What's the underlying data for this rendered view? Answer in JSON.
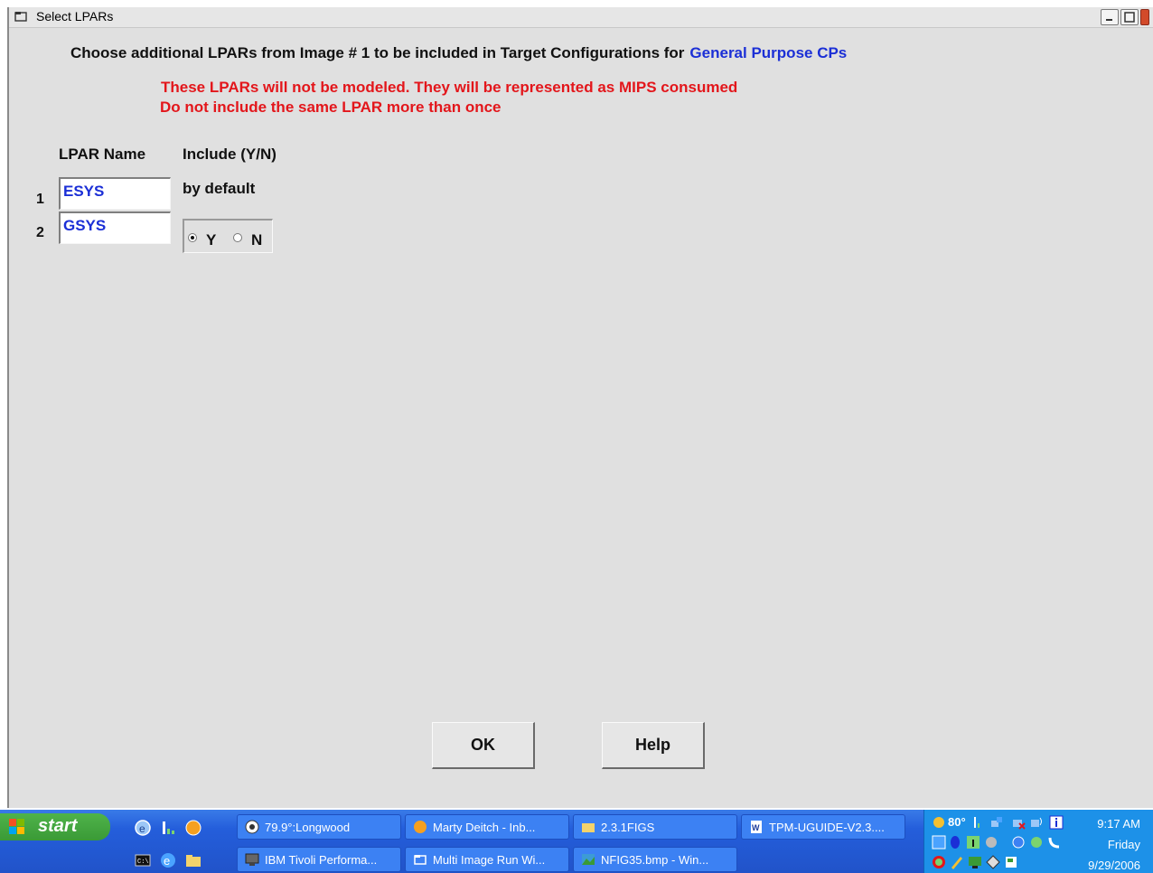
{
  "window": {
    "title": "Select LPARs"
  },
  "instruction": {
    "text": "Choose additional LPARs from Image # 1 to be included in Target Configurations for",
    "highlight": "General Purpose CPs"
  },
  "warnings": [
    "These LPARs will not be modeled. They will be represented as MIPS consumed",
    "Do not include the same LPAR more than once"
  ],
  "table": {
    "col_lpar": "LPAR Name",
    "col_include": "Include (Y/N)",
    "by_default": "by default",
    "rows": [
      {
        "num": "1",
        "name": "ESYS"
      },
      {
        "num": "2",
        "name": "GSYS"
      }
    ],
    "radio_y": "Y",
    "radio_n": "N",
    "selected": "Y"
  },
  "buttons": {
    "ok": "OK",
    "help": "Help"
  },
  "taskbar": {
    "start": "start",
    "tasks": [
      {
        "label": "79.9°:Longwood",
        "icon": "weather-icon"
      },
      {
        "label": "Marty Deitch - Inb...",
        "icon": "mail-icon"
      },
      {
        "label": "2.3.1FIGS",
        "icon": "folder-icon"
      },
      {
        "label": "TPM-UGUIDE-V2.3....",
        "icon": "word-icon"
      },
      {
        "label": "IBM Tivoli Performa...",
        "icon": "monitor-icon"
      },
      {
        "label": "Multi Image Run Wi...",
        "icon": "window-icon"
      },
      {
        "label": "NFIG35.bmp - Win...",
        "icon": "image-icon"
      }
    ],
    "tray": {
      "temperature": "80°",
      "time": "9:17 AM",
      "day": "Friday",
      "date": "9/29/2006"
    }
  }
}
